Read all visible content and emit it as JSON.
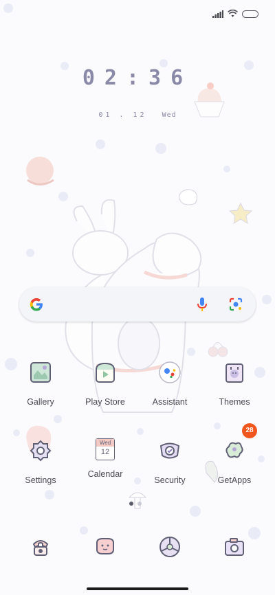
{
  "clock": {
    "digits": [
      "0",
      "2",
      ":",
      "3",
      "6"
    ]
  },
  "date": {
    "date": "01 . 12",
    "weekday": "Wed"
  },
  "apps": [
    {
      "label": "Gallery"
    },
    {
      "label": "Play Store"
    },
    {
      "label": "Assistant"
    },
    {
      "label": "Themes"
    },
    {
      "label": "Settings"
    },
    {
      "label": "Calendar",
      "icon_text": "Wed",
      "icon_day": "12"
    },
    {
      "label": "Security"
    },
    {
      "label": "GetApps",
      "badge": "28"
    }
  ],
  "dock": [
    "phone-icon",
    "messages-icon",
    "browser-icon",
    "camera-icon"
  ],
  "colors": {
    "accent": "#8a89a8",
    "badge": "#f0561d",
    "background": "#fbfbfd"
  }
}
